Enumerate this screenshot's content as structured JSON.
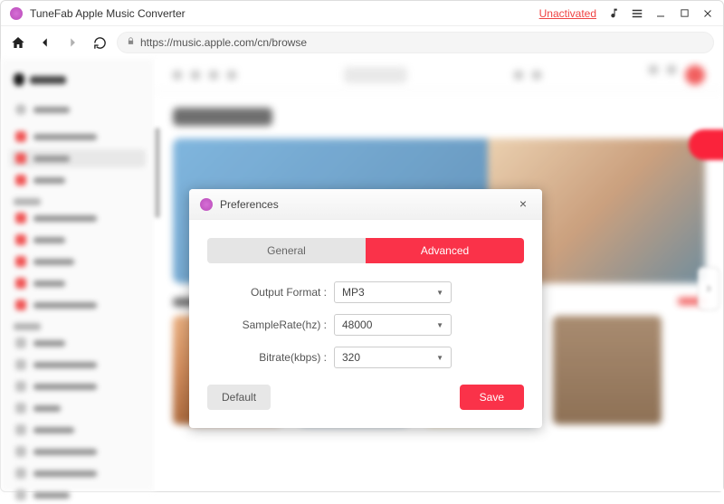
{
  "titlebar": {
    "app_name": "TuneFab Apple Music Converter",
    "unactivated": "Unactivated"
  },
  "url": "https://music.apple.com/cn/browse",
  "modal": {
    "title": "Preferences",
    "tabs": {
      "general": "General",
      "advanced": "Advanced"
    },
    "labels": {
      "output_format": "Output Format :",
      "sample_rate": "SampleRate(hz) :",
      "bitrate": "Bitrate(kbps) :"
    },
    "values": {
      "output_format": "MP3",
      "sample_rate": "48000",
      "bitrate": "320"
    },
    "buttons": {
      "default": "Default",
      "save": "Save"
    }
  }
}
